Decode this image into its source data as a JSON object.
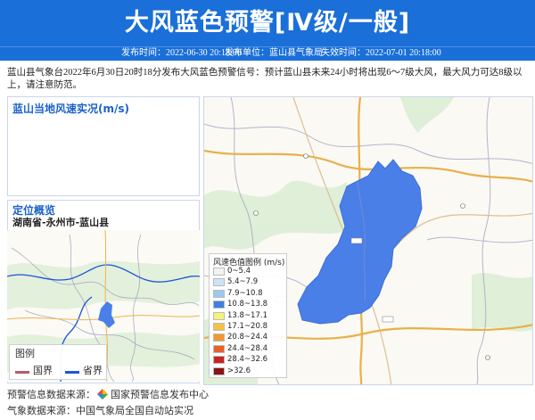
{
  "header": {
    "title": "大风蓝色预警[Ⅳ级/一般]",
    "publish_time": "发布时间：2022-06-30 20:18:00",
    "publisher": "发布单位：蓝山县气象局",
    "expire_time": "失效时间：2022-07-01 20:18:00"
  },
  "description": "蓝山县气象台2022年6月30日20时18分发布大风蓝色预警信号：预计蓝山县未来24小时将出现6～7级大风，最大风力可达8级以上，请注意防范。",
  "wind_panel": {
    "title": "蓝山当地风速实况(m/s)"
  },
  "location_panel": {
    "title": "定位概览",
    "location": "湖南省-永州市-蓝山县"
  },
  "mini_map": {
    "legend_title": "图例",
    "legend_items": [
      {
        "label": "国界",
        "color": "#c0566a"
      },
      {
        "label": "省界",
        "color": "#1a56d6"
      }
    ]
  },
  "wind_legend": {
    "title": "风速色值图例 (m/s)",
    "items": [
      {
        "label": "0~5.4",
        "color": "#f2f2f2"
      },
      {
        "label": "5.4~7.9",
        "color": "#cfe3f7"
      },
      {
        "label": "7.9~10.8",
        "color": "#9fc8f0"
      },
      {
        "label": "10.8~13.8",
        "color": "#3f7fe0"
      },
      {
        "label": "13.8~17.1",
        "color": "#f7f17a"
      },
      {
        "label": "17.1~20.8",
        "color": "#f5c243"
      },
      {
        "label": "20.8~24.4",
        "color": "#ef9a30"
      },
      {
        "label": "24.4~28.4",
        "color": "#e8612a"
      },
      {
        "label": "28.4~32.6",
        "color": "#c9241f"
      },
      {
        "label": ">32.6",
        "color": "#8a1414"
      }
    ]
  },
  "footer": {
    "warning_source_label": "预警信息数据来源：",
    "warning_source_name": "国家预警信息发布中心",
    "weather_source": "气象数据来源：中国气象局全国自动站实况"
  },
  "colors": {
    "header_bg": "#1a6fd8",
    "warning_area": "#4a7fe8",
    "panel_title": "#1a62c9"
  }
}
